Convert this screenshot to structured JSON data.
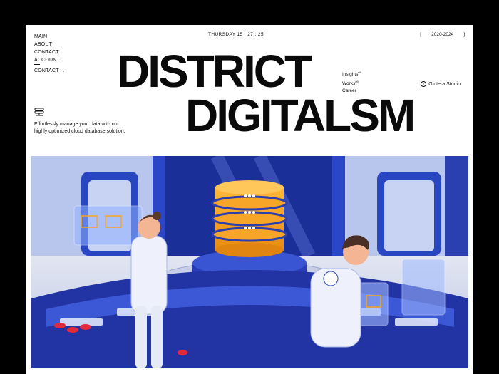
{
  "nav": {
    "items": [
      "MAIN",
      "ABOUT",
      "CONTACT",
      "ACCOUNT",
      "CONTACT →"
    ]
  },
  "clock": "THURSDAY 15 : 27 : 25",
  "years": {
    "open": "[",
    "range": "2020-2024",
    "close": "]"
  },
  "headline": {
    "line1": "DISTRICT",
    "line2": "DIGITALSM"
  },
  "sublinks": [
    {
      "label": "Insights",
      "sup": "09"
    },
    {
      "label": "Works",
      "sup": "09"
    },
    {
      "label": "Career",
      "sup": ""
    }
  ],
  "studio": "Gintera Studio",
  "tagline": "Effortlessly manage your data with our highly optimized cloud database solution.",
  "icons": [
    "database-icon",
    "arrow-right-icon",
    "copyright-icon"
  ],
  "colors": {
    "accent_blue": "#2848c8",
    "orange": "#f5a523",
    "text": "#0a0a0a",
    "background": "#ffffff"
  }
}
